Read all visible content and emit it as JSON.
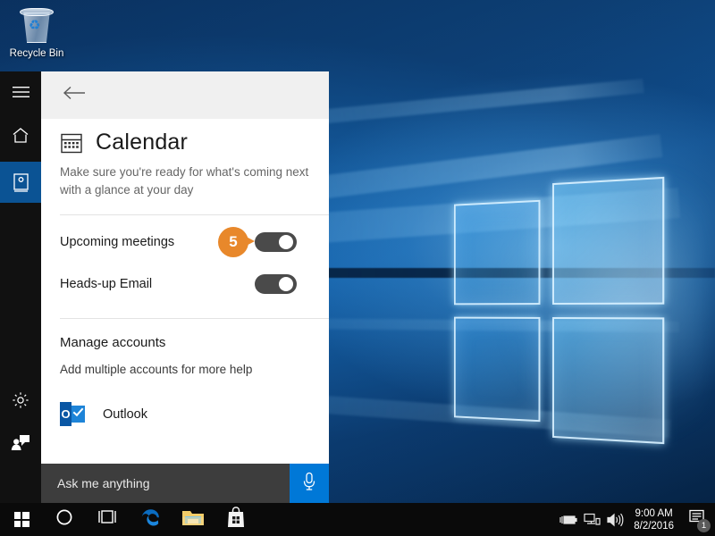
{
  "desktop": {
    "recycle_bin_label": "Recycle Bin",
    "recycle_bin_icon": "recycle-bin-icon",
    "wallpaper": "windows-10-hero-wallpaper"
  },
  "cortana": {
    "back_icon": "back-arrow-icon",
    "rail": [
      {
        "icon": "hamburger-menu-icon",
        "name": "menu",
        "selected": false
      },
      {
        "icon": "home-icon",
        "name": "home",
        "selected": false
      },
      {
        "icon": "notebook-icon",
        "name": "notebook",
        "selected": true
      },
      {
        "icon": "gear-icon",
        "name": "settings",
        "selected": false
      },
      {
        "icon": "feedback-icon",
        "name": "feedback",
        "selected": false
      }
    ],
    "page": {
      "icon": "calendar-icon",
      "title": "Calendar",
      "description": "Make sure you're ready for what's coming next with a glance at your day"
    },
    "settings": [
      {
        "label": "Upcoming meetings",
        "toggle_state": "on"
      },
      {
        "label": "Heads-up Email",
        "toggle_state": "on"
      }
    ],
    "callout": {
      "number": "5",
      "color": "#e8882b"
    },
    "accounts_section": {
      "heading": "Manage accounts",
      "subtext": "Add multiple accounts for more help",
      "items": [
        {
          "name": "Outlook",
          "icon": "outlook-icon"
        }
      ]
    },
    "search": {
      "placeholder": "Ask me anything",
      "mic_icon": "microphone-icon",
      "mic_color": "#0078d7"
    }
  },
  "taskbar": {
    "items": [
      {
        "name": "start-button",
        "icon": "windows-logo-icon"
      },
      {
        "name": "cortana-button",
        "icon": "circle-icon"
      },
      {
        "name": "task-view-button",
        "icon": "task-view-icon"
      },
      {
        "name": "edge-button",
        "icon": "edge-icon"
      },
      {
        "name": "file-explorer-button",
        "icon": "folder-icon"
      },
      {
        "name": "store-button",
        "icon": "store-bag-icon"
      }
    ],
    "tray": [
      {
        "name": "power-icon",
        "icon": "battery-icon"
      },
      {
        "name": "network-icon",
        "icon": "network-icon"
      },
      {
        "name": "volume-icon",
        "icon": "speaker-icon"
      }
    ],
    "clock": {
      "time": "9:00 AM",
      "date": "8/2/2016"
    },
    "action_center": {
      "icon": "action-center-icon",
      "badge": "1"
    }
  }
}
